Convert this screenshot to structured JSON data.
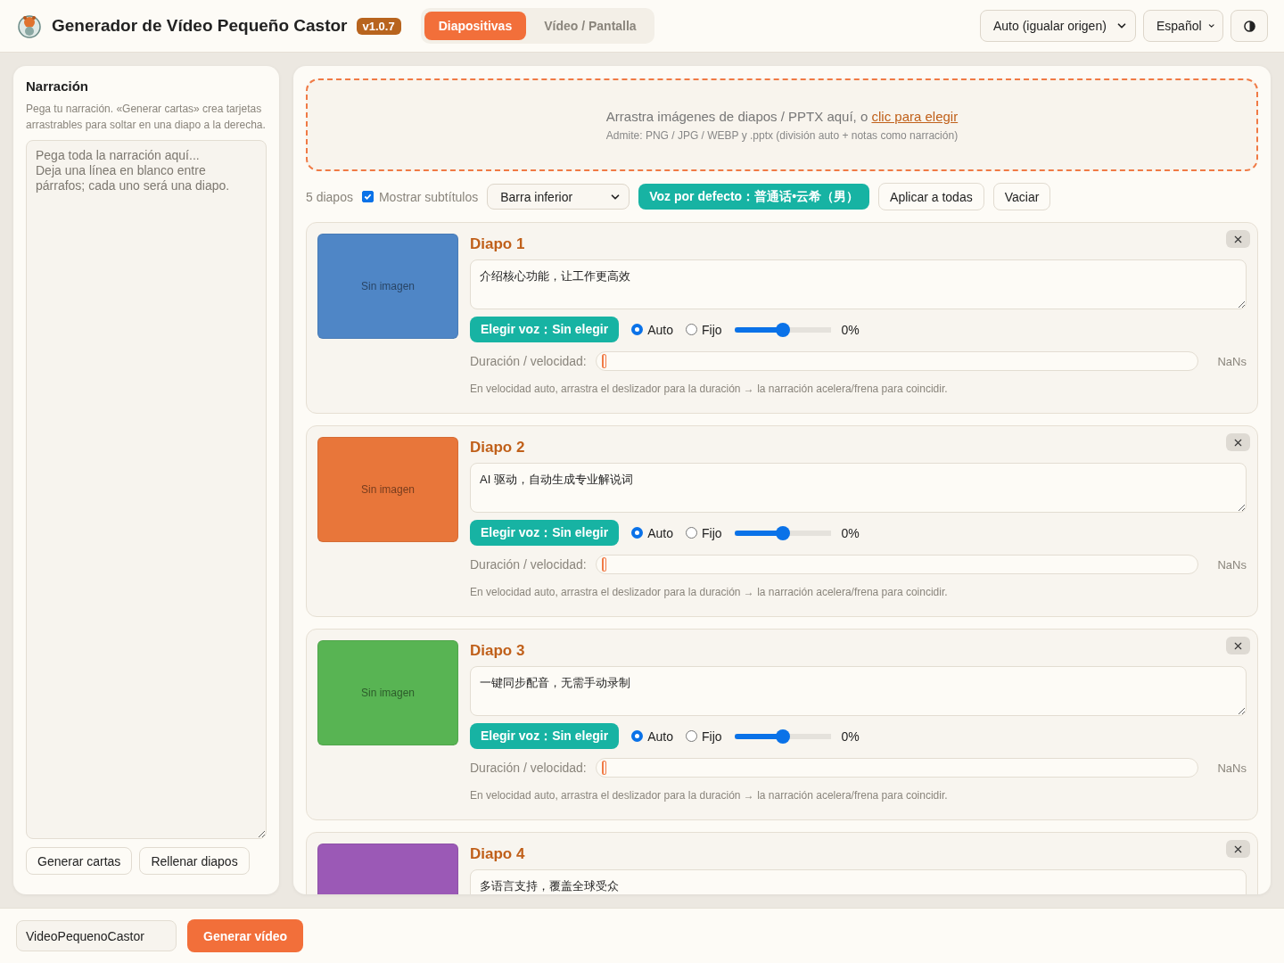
{
  "header": {
    "title": "Generador de Vídeo Pequeño Castor",
    "version": "v1.0.7",
    "tabs": [
      {
        "label": "Diapositivas",
        "selected": true
      },
      {
        "label": "Vídeo / Pantalla",
        "selected": false
      }
    ],
    "resolution_select": "Auto (igualar origen)",
    "language_select": "Español"
  },
  "narration": {
    "title": "Narración",
    "description": "Pega tu narración. «Generar cartas» crea tarjetas arrastrables para soltar en una diapo a la derecha.",
    "placeholder": "Pega toda la narración aquí...\nDeja una línea en blanco entre párrafos; cada uno será una diapo.",
    "buttons": [
      "Generar cartas",
      "Rellenar diapos"
    ]
  },
  "dropzone": {
    "text": "Arrastra imágenes de diapos / PPTX aquí, o ",
    "link": "clic para elegir",
    "hint": "Admite: PNG / JPG / WEBP y .pptx (división auto + notas como narración)"
  },
  "toolbar": {
    "count": "5 diapos",
    "subtitles": {
      "label": "Mostrar subtítulos",
      "checked": true
    },
    "position_select": "Barra inferior",
    "default_voice": "Voz por defecto：普通话•云希（男）",
    "buttons": [
      "Aplicar a todas",
      "Vaciar"
    ]
  },
  "slides": [
    {
      "title": "Diapo 1",
      "color": "#4f86c6",
      "placeholder": "Sin imagen",
      "text": "介绍核心功能，让工作更高效",
      "voice_button": "Elegir voz：Sin elegir",
      "modes": [
        {
          "label": "Auto",
          "selected": true
        },
        {
          "label": "Fijo",
          "selected": false
        }
      ],
      "speed": {
        "level": 0.5,
        "reading": "0%"
      },
      "duration": {
        "label": "Duración / velocidad:",
        "level": 0,
        "reading": "NaNs"
      },
      "hint": "En velocidad auto, arrastra el deslizador para la duración → la narración acelera/frena para coincidir."
    },
    {
      "title": "Diapo 2",
      "color": "#e8763a",
      "placeholder": "Sin imagen",
      "text": "AI 驱动，自动生成专业解说词",
      "voice_button": "Elegir voz：Sin elegir",
      "modes": [
        {
          "label": "Auto",
          "selected": true
        },
        {
          "label": "Fijo",
          "selected": false
        }
      ],
      "speed": {
        "level": 0.5,
        "reading": "0%"
      },
      "duration": {
        "label": "Duración / velocidad:",
        "level": 0,
        "reading": "NaNs"
      },
      "hint": "En velocidad auto, arrastra el deslizador para la duración → la narración acelera/frena para coincidir."
    },
    {
      "title": "Diapo 3",
      "color": "#58b453",
      "placeholder": "Sin imagen",
      "text": "一键同步配音，无需手动录制",
      "voice_button": "Elegir voz：Sin elegir",
      "modes": [
        {
          "label": "Auto",
          "selected": true
        },
        {
          "label": "Fijo",
          "selected": false
        }
      ],
      "speed": {
        "level": 0.5,
        "reading": "0%"
      },
      "duration": {
        "label": "Duración / velocidad:",
        "level": 0,
        "reading": "NaNs"
      },
      "hint": "En velocidad auto, arrastra el deslizador para la duración → la narración acelera/frena para coincidir."
    },
    {
      "title": "Diapo 4",
      "color": "#9b59b6",
      "text": "多语言支持，覆盖全球受众"
    }
  ],
  "footer": {
    "filename": "VideoPequenoCastor",
    "generate": "Generar vídeo"
  }
}
